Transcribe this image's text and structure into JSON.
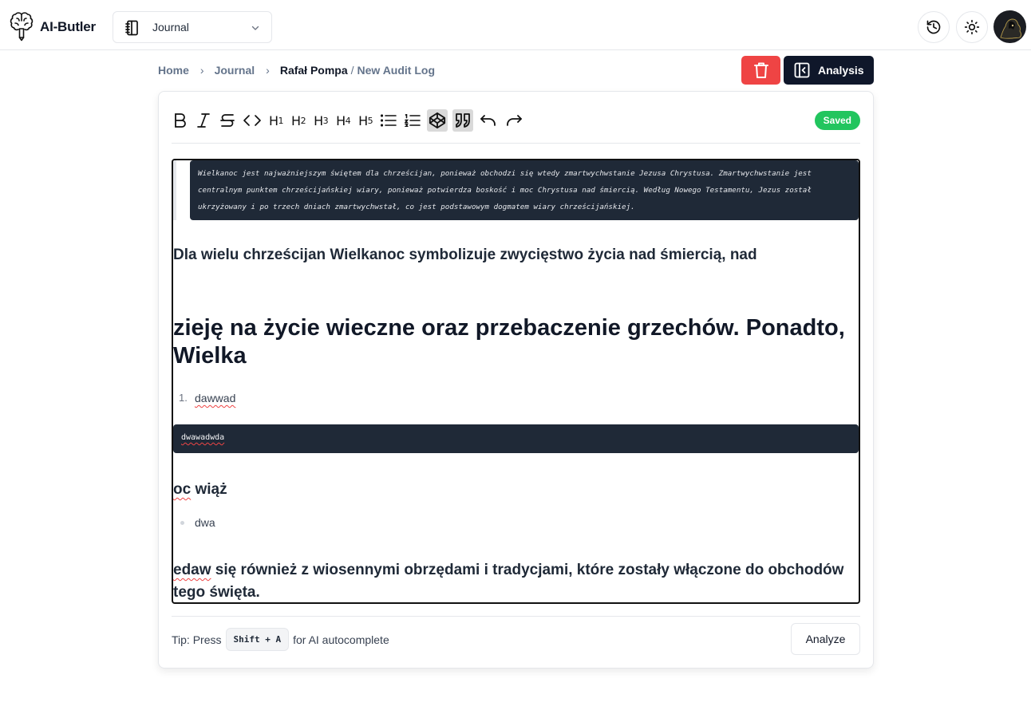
{
  "app": {
    "brand": "AI-Butler",
    "logo_icon": "brain-pencil-icon"
  },
  "workspace_selector": {
    "icon": "notebook-icon",
    "selected": "Journal"
  },
  "header_actions": {
    "history_icon": "history-icon",
    "theme_icon": "sun-icon",
    "avatar_icon": "hooded-figure-avatar"
  },
  "breadcrumb": {
    "items": [
      "Home",
      "Journal"
    ],
    "current": "Rafał Pompa",
    "separator": "/",
    "subtitle": "New Audit Log"
  },
  "actions": {
    "delete_icon": "trash-icon",
    "analysis_label": "Analysis",
    "analysis_icon": "sidebar-collapse-icon"
  },
  "toolbar": {
    "buttons": [
      {
        "name": "bold",
        "label": "B"
      },
      {
        "name": "italic",
        "label": "I"
      },
      {
        "name": "strikethrough",
        "label": "S"
      },
      {
        "name": "code",
        "label": "<>"
      },
      {
        "name": "h1",
        "label": "H1"
      },
      {
        "name": "h2",
        "label": "H2"
      },
      {
        "name": "h3",
        "label": "H3"
      },
      {
        "name": "h4",
        "label": "H4"
      },
      {
        "name": "h5",
        "label": "H5"
      },
      {
        "name": "bullet-list",
        "label": "bullet list"
      },
      {
        "name": "ordered-list",
        "label": "ordered list"
      },
      {
        "name": "code-block",
        "label": "code block",
        "active": true
      },
      {
        "name": "blockquote",
        "label": "quote",
        "active": true
      },
      {
        "name": "undo",
        "label": "undo"
      },
      {
        "name": "redo",
        "label": "redo"
      }
    ],
    "status": "Saved",
    "status_color": "#22c55e"
  },
  "document": {
    "quote_code": "Wielkanoc jest najważniejszym świętem dla chrześcijan, ponieważ obchodzi się wtedy zmartwychwstanie Jezusa Chrystusa. Zmartwychwstanie jest centralnym punktem chrześcijańskiej wiary, ponieważ potwierdza boskość i moc Chrystusa nad śmiercią. Według Nowego Testamentu, Jezus został ukrzyżowany i po trzech dniach zmartwychwstał, co jest podstawowym dogmatem wiary chrześcijańskiej.",
    "heading4": "Dla wielu chrześcijan Wielkanoc symbolizuje zwycięstwo życia nad śmiercią, nad",
    "heading1": "zieję na życie wieczne oraz przebaczenie grzechów. Ponadto, Wielka",
    "ordered_list": [
      {
        "number": "1.",
        "text": "dawwad"
      }
    ],
    "code_block": "dwawadwda",
    "heading_short": {
      "misspelled": "oc",
      "rest": " wiąż"
    },
    "bullet_list": [
      "dwa"
    ],
    "last_paragraph": {
      "misspelled": "edaw",
      "rest": " się również z wiosennymi obrzędami i tradycjami, które zostały włączone do obchodów tego święta."
    }
  },
  "footer": {
    "tip_prefix": "Tip: Press",
    "shortcut": "Shift + A",
    "tip_suffix": "for AI autocomplete",
    "analyze_label": "Analyze"
  },
  "colors": {
    "danger": "#ef4444",
    "primary_dark": "#0f172a",
    "code_bg": "#1f2937",
    "success": "#22c55e"
  }
}
